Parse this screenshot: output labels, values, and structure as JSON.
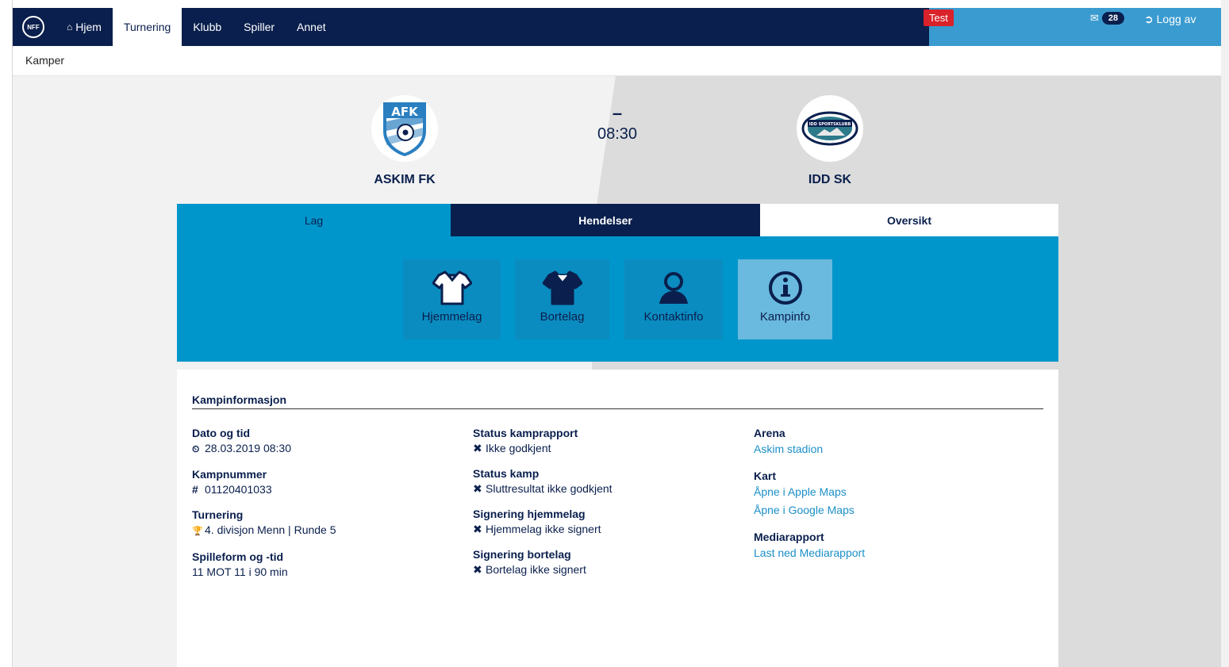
{
  "nav": {
    "logo_text": "NFF",
    "items": [
      {
        "label": "Hjem",
        "icon": "home-icon"
      },
      {
        "label": "Turnering"
      },
      {
        "label": "Klubb"
      },
      {
        "label": "Spiller"
      },
      {
        "label": "Annet"
      }
    ],
    "active": "Turnering",
    "env_badge": "Test",
    "messages_count": "28",
    "logout_label": "Logg av"
  },
  "breadcrumb": "Kamper",
  "match": {
    "home_team": "ASKIM FK",
    "home_logo_text": "AFK",
    "away_team": "IDD SK",
    "away_logo_text": "IDD SPORTSKLUBB",
    "score_separator": "–",
    "kickoff": "08:30"
  },
  "tabs": [
    {
      "label": "Lag"
    },
    {
      "label": "Hendelser"
    },
    {
      "label": "Oversikt"
    }
  ],
  "subtabs": [
    {
      "label": "Hjemmelag",
      "icon": "home-shirt-icon"
    },
    {
      "label": "Bortelag",
      "icon": "away-shirt-icon"
    },
    {
      "label": "Kontaktinfo",
      "icon": "person-icon"
    },
    {
      "label": "Kampinfo",
      "icon": "info-icon",
      "active": true
    }
  ],
  "info": {
    "title": "Kampinformasjon",
    "col1": [
      {
        "label": "Dato og tid",
        "value": "28.03.2019 08:30",
        "icon": "clock-icon",
        "glyph": "⏲"
      },
      {
        "label": "Kampnummer",
        "value": "01120401033",
        "icon": "hash-icon",
        "glyph": "#"
      },
      {
        "label": "Turnering",
        "value": "4. divisjon Menn | Runde 5",
        "icon": "trophy-icon",
        "glyph": "🏆"
      },
      {
        "label": "Spilleform og -tid",
        "value": "11 MOT 11 i 90 min"
      }
    ],
    "col2": [
      {
        "label": "Status kamprapport",
        "value": "Ikke godkjent",
        "icon": "cross-icon",
        "glyph": "✖"
      },
      {
        "label": "Status kamp",
        "value": "Sluttresultat ikke godkjent",
        "icon": "cross-icon",
        "glyph": "✖"
      },
      {
        "label": "Signering hjemmelag",
        "value": "Hjemmelag ikke signert",
        "icon": "cross-icon",
        "glyph": "✖"
      },
      {
        "label": "Signering bortelag",
        "value": "Bortelag ikke signert",
        "icon": "cross-icon",
        "glyph": "✖"
      }
    ],
    "arena_label": "Arena",
    "arena_link": "Askim stadion",
    "map_label": "Kart",
    "apple_maps_link": "Åpne i Apple Maps",
    "google_maps_link": "Åpne i Google Maps",
    "media_label": "Mediarapport",
    "media_link": "Last ned Mediarapport"
  },
  "colors": {
    "navy": "#0a1f4d",
    "blue": "#0096cb",
    "light_blue": "#3a9bd0",
    "red_badge": "#d9222a",
    "link": "#1c8fc8"
  }
}
